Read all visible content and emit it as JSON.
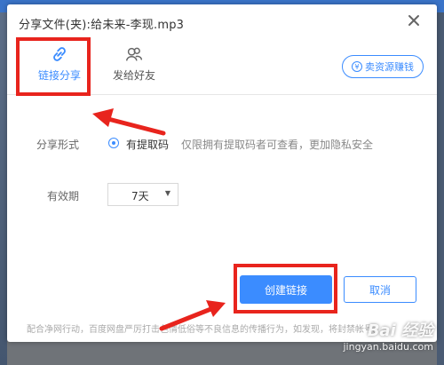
{
  "dialog": {
    "title": "分享文件(夹):给未来-李现.mp3"
  },
  "tabs": [
    {
      "label": "链接分享",
      "icon": "link-icon",
      "active": true
    },
    {
      "label": "发给好友",
      "icon": "friends-icon",
      "active": false
    }
  ],
  "earn_button": {
    "label": "卖资源赚钱",
    "icon": "yen-icon"
  },
  "share_form": {
    "label": "分享形式",
    "option_label": "有提取码",
    "option_desc": "仅限拥有提取码者可查看，更加隐私安全",
    "selected": true
  },
  "validity": {
    "label": "有效期",
    "value": "7天"
  },
  "buttons": {
    "create": "创建链接",
    "cancel": "取消"
  },
  "footer_note": "配合净网行动，百度网盘严厉打击色情低俗等不良信息的传播行为，如发现，将封禁帐号。",
  "watermark": {
    "logo": "Bai 经验",
    "url": "jingyan.baidu.com"
  },
  "colors": {
    "accent": "#3b8cff",
    "annotation_red": "#e8241d"
  }
}
